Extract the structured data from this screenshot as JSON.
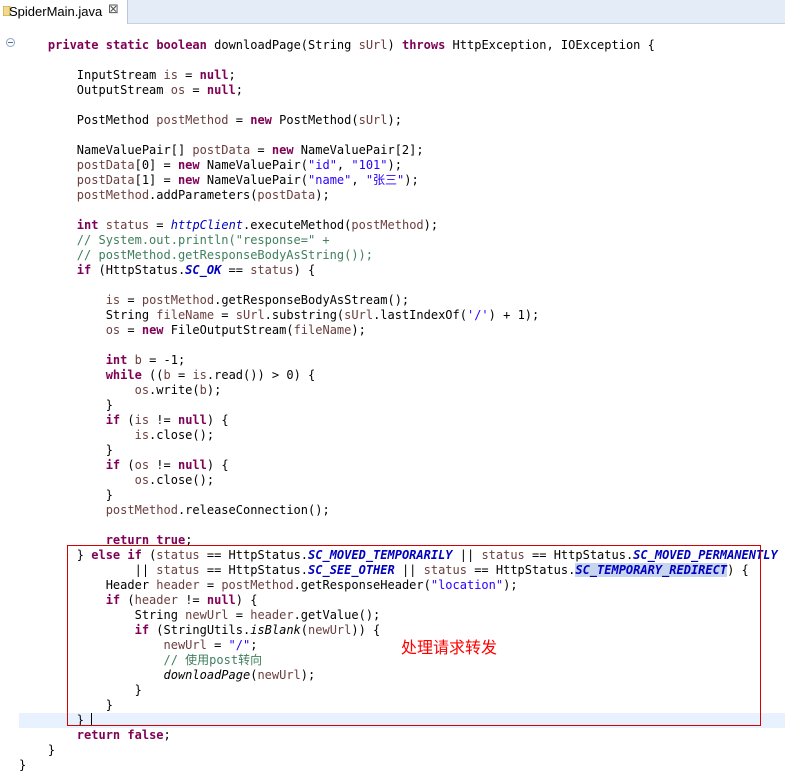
{
  "tab": {
    "label": "SpiderMain.java",
    "close": "⊠"
  },
  "annotation": {
    "text": "处理请求转发"
  },
  "code": [
    [
      [
        "    ",
        ""
      ],
      [
        "private",
        "kw"
      ],
      [
        " ",
        ""
      ],
      [
        "static",
        "kw"
      ],
      [
        " ",
        ""
      ],
      [
        "boolean",
        "kw"
      ],
      [
        " downloadPage(String ",
        ""
      ],
      [
        "sUrl",
        "var"
      ],
      [
        ") ",
        ""
      ],
      [
        "throws",
        "kw"
      ],
      [
        " HttpException, IOException {",
        ""
      ]
    ],
    [],
    [
      [
        "        InputStream ",
        ""
      ],
      [
        "is",
        "var"
      ],
      [
        " = ",
        ""
      ],
      [
        "null",
        "kw"
      ],
      [
        ";",
        ""
      ]
    ],
    [
      [
        "        OutputStream ",
        ""
      ],
      [
        "os",
        "var"
      ],
      [
        " = ",
        ""
      ],
      [
        "null",
        "kw"
      ],
      [
        ";",
        ""
      ]
    ],
    [],
    [
      [
        "        PostMethod ",
        ""
      ],
      [
        "postMethod",
        "var"
      ],
      [
        " = ",
        ""
      ],
      [
        "new",
        "kw"
      ],
      [
        " PostMethod(",
        ""
      ],
      [
        "sUrl",
        "var"
      ],
      [
        ");",
        ""
      ]
    ],
    [],
    [
      [
        "        NameValuePair[] ",
        ""
      ],
      [
        "postData",
        "var"
      ],
      [
        " = ",
        ""
      ],
      [
        "new",
        "kw"
      ],
      [
        " NameValuePair[2];",
        ""
      ]
    ],
    [
      [
        "        ",
        ""
      ],
      [
        "postData",
        "var"
      ],
      [
        "[0] = ",
        ""
      ],
      [
        "new",
        "kw"
      ],
      [
        " NameValuePair(",
        ""
      ],
      [
        "\"id\"",
        "str"
      ],
      [
        ", ",
        ""
      ],
      [
        "\"101\"",
        "str"
      ],
      [
        ");",
        ""
      ]
    ],
    [
      [
        "        ",
        ""
      ],
      [
        "postData",
        "var"
      ],
      [
        "[1] = ",
        ""
      ],
      [
        "new",
        "kw"
      ],
      [
        " NameValuePair(",
        ""
      ],
      [
        "\"name\"",
        "str"
      ],
      [
        ", ",
        ""
      ],
      [
        "\"张三\"",
        "str"
      ],
      [
        ");",
        ""
      ]
    ],
    [
      [
        "        ",
        ""
      ],
      [
        "postMethod",
        "var"
      ],
      [
        ".addParameters(",
        ""
      ],
      [
        "postData",
        "var"
      ],
      [
        ");",
        ""
      ]
    ],
    [],
    [
      [
        "        ",
        ""
      ],
      [
        "int",
        "kw"
      ],
      [
        " ",
        ""
      ],
      [
        "status",
        "var"
      ],
      [
        " = ",
        ""
      ],
      [
        "httpClient",
        "field"
      ],
      [
        ".executeMethod(",
        ""
      ],
      [
        "postMethod",
        "var"
      ],
      [
        ");",
        ""
      ]
    ],
    [
      [
        "        ",
        ""
      ],
      [
        "// System.out.println(\"response=\" +",
        "cm"
      ]
    ],
    [
      [
        "        ",
        ""
      ],
      [
        "// postMethod.getResponseBodyAsString());",
        "cm"
      ]
    ],
    [
      [
        "        ",
        ""
      ],
      [
        "if",
        "kw"
      ],
      [
        " (HttpStatus.",
        ""
      ],
      [
        "SC_OK",
        "sfield"
      ],
      [
        " == ",
        ""
      ],
      [
        "status",
        "var"
      ],
      [
        ") {",
        ""
      ]
    ],
    [],
    [
      [
        "            ",
        ""
      ],
      [
        "is",
        "var"
      ],
      [
        " = ",
        ""
      ],
      [
        "postMethod",
        "var"
      ],
      [
        ".getResponseBodyAsStream();",
        ""
      ]
    ],
    [
      [
        "            String ",
        ""
      ],
      [
        "fileName",
        "var"
      ],
      [
        " = ",
        ""
      ],
      [
        "sUrl",
        "var"
      ],
      [
        ".substring(",
        ""
      ],
      [
        "sUrl",
        "var"
      ],
      [
        ".lastIndexOf(",
        ""
      ],
      [
        "'/'",
        "str"
      ],
      [
        ") + 1);",
        ""
      ]
    ],
    [
      [
        "            ",
        ""
      ],
      [
        "os",
        "var"
      ],
      [
        " = ",
        ""
      ],
      [
        "new",
        "kw"
      ],
      [
        " FileOutputStream(",
        ""
      ],
      [
        "fileName",
        "var"
      ],
      [
        ");",
        ""
      ]
    ],
    [],
    [
      [
        "            ",
        ""
      ],
      [
        "int",
        "kw"
      ],
      [
        " ",
        ""
      ],
      [
        "b",
        "var"
      ],
      [
        " = -1;",
        ""
      ]
    ],
    [
      [
        "            ",
        ""
      ],
      [
        "while",
        "kw"
      ],
      [
        " ((",
        ""
      ],
      [
        "b",
        "var"
      ],
      [
        " = ",
        ""
      ],
      [
        "is",
        "var"
      ],
      [
        ".read()) > 0) {",
        ""
      ]
    ],
    [
      [
        "                ",
        ""
      ],
      [
        "os",
        "var"
      ],
      [
        ".write(",
        ""
      ],
      [
        "b",
        "var"
      ],
      [
        ");",
        ""
      ]
    ],
    [
      [
        "            }",
        ""
      ]
    ],
    [
      [
        "            ",
        ""
      ],
      [
        "if",
        "kw"
      ],
      [
        " (",
        ""
      ],
      [
        "is",
        "var"
      ],
      [
        " != ",
        ""
      ],
      [
        "null",
        "kw"
      ],
      [
        ") {",
        ""
      ]
    ],
    [
      [
        "                ",
        ""
      ],
      [
        "is",
        "var"
      ],
      [
        ".close();",
        ""
      ]
    ],
    [
      [
        "            }",
        ""
      ]
    ],
    [
      [
        "            ",
        ""
      ],
      [
        "if",
        "kw"
      ],
      [
        " (",
        ""
      ],
      [
        "os",
        "var"
      ],
      [
        " != ",
        ""
      ],
      [
        "null",
        "kw"
      ],
      [
        ") {",
        ""
      ]
    ],
    [
      [
        "                ",
        ""
      ],
      [
        "os",
        "var"
      ],
      [
        ".close();",
        ""
      ]
    ],
    [
      [
        "            }",
        ""
      ]
    ],
    [
      [
        "            ",
        ""
      ],
      [
        "postMethod",
        "var"
      ],
      [
        ".releaseConnection();",
        ""
      ]
    ],
    [],
    [
      [
        "            ",
        ""
      ],
      [
        "return",
        "kw"
      ],
      [
        " ",
        ""
      ],
      [
        "true",
        "kw"
      ],
      [
        ";",
        ""
      ]
    ],
    [
      [
        "        } ",
        ""
      ],
      [
        "else",
        "kw"
      ],
      [
        " ",
        ""
      ],
      [
        "if",
        "kw"
      ],
      [
        " (",
        ""
      ],
      [
        "status",
        "var"
      ],
      [
        " == HttpStatus.",
        ""
      ],
      [
        "SC_MOVED_TEMPORARILY",
        "sfield"
      ],
      [
        " || ",
        ""
      ],
      [
        "status",
        "var"
      ],
      [
        " == HttpStatus.",
        ""
      ],
      [
        "SC_MOVED_PERMANENTLY",
        "sfield"
      ]
    ],
    [
      [
        "                || ",
        ""
      ],
      [
        "status",
        "var"
      ],
      [
        " == HttpStatus.",
        ""
      ],
      [
        "SC_SEE_OTHER",
        "sfield"
      ],
      [
        " || ",
        ""
      ],
      [
        "status",
        "var"
      ],
      [
        " == HttpStatus.",
        ""
      ],
      [
        "SC_TEMPORARY_REDIRECT",
        "sfield hl"
      ],
      [
        ") {",
        ""
      ]
    ],
    [
      [
        "            Header ",
        ""
      ],
      [
        "header",
        "var"
      ],
      [
        " = ",
        ""
      ],
      [
        "postMethod",
        "var"
      ],
      [
        ".getResponseHeader(",
        ""
      ],
      [
        "\"location\"",
        "str"
      ],
      [
        ");",
        ""
      ]
    ],
    [
      [
        "            ",
        ""
      ],
      [
        "if",
        "kw"
      ],
      [
        " (",
        ""
      ],
      [
        "header",
        "var"
      ],
      [
        " != ",
        ""
      ],
      [
        "null",
        "kw"
      ],
      [
        ") {",
        ""
      ]
    ],
    [
      [
        "                String ",
        ""
      ],
      [
        "newUrl",
        "var"
      ],
      [
        " = ",
        ""
      ],
      [
        "header",
        "var"
      ],
      [
        ".getValue();",
        ""
      ]
    ],
    [
      [
        "                ",
        ""
      ],
      [
        "if",
        "kw"
      ],
      [
        " (StringUtils.",
        ""
      ],
      [
        "isBlank",
        "smeth"
      ],
      [
        "(",
        ""
      ],
      [
        "newUrl",
        "var"
      ],
      [
        ")) {",
        ""
      ]
    ],
    [
      [
        "                    ",
        ""
      ],
      [
        "newUrl",
        "var"
      ],
      [
        " = ",
        ""
      ],
      [
        "\"/\"",
        "str"
      ],
      [
        ";",
        ""
      ]
    ],
    [
      [
        "                    ",
        ""
      ],
      [
        "// 使用post转向",
        "cm"
      ]
    ],
    [
      [
        "                    ",
        ""
      ],
      [
        "downloadPage",
        "smeth"
      ],
      [
        "(",
        ""
      ],
      [
        "newUrl",
        "var"
      ],
      [
        ");",
        ""
      ]
    ],
    [
      [
        "                }",
        ""
      ]
    ],
    [
      [
        "            }",
        ""
      ]
    ],
    [
      [
        "        }",
        ""
      ]
    ],
    [
      [
        "        ",
        ""
      ],
      [
        "return",
        "kw"
      ],
      [
        " ",
        ""
      ],
      [
        "false",
        "kw"
      ],
      [
        ";",
        ""
      ]
    ],
    [
      [
        "    }",
        ""
      ]
    ],
    [
      [
        "}",
        ""
      ]
    ]
  ]
}
